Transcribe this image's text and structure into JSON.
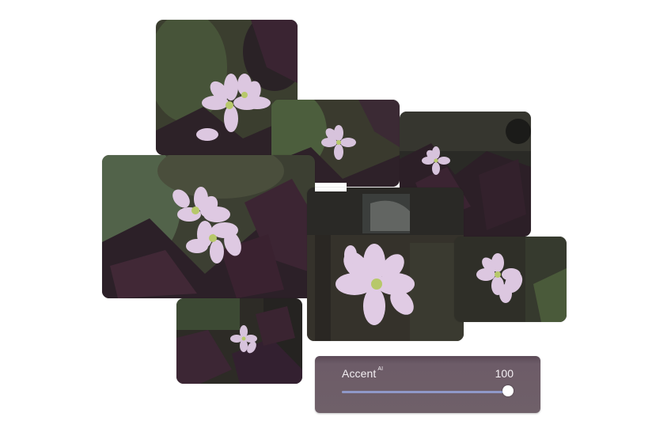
{
  "slider": {
    "label": "Accent",
    "label_badge": "AI",
    "value": "100",
    "level": 1.0
  },
  "photos": [
    {
      "name": "photo-top-left"
    },
    {
      "name": "photo-center-top"
    },
    {
      "name": "photo-right-top"
    },
    {
      "name": "photo-left-large"
    },
    {
      "name": "photo-center-large"
    },
    {
      "name": "photo-right-small"
    },
    {
      "name": "photo-bottom-left"
    }
  ],
  "colors": {
    "background": "#ffffff",
    "foliage_dark": "#2b2228",
    "foliage_purple": "#4a2e3f",
    "petal": "#d9c4de",
    "flower_center": "#b7c86a",
    "slider_fill": "#8f98c8",
    "panel": "#6d5c68"
  }
}
